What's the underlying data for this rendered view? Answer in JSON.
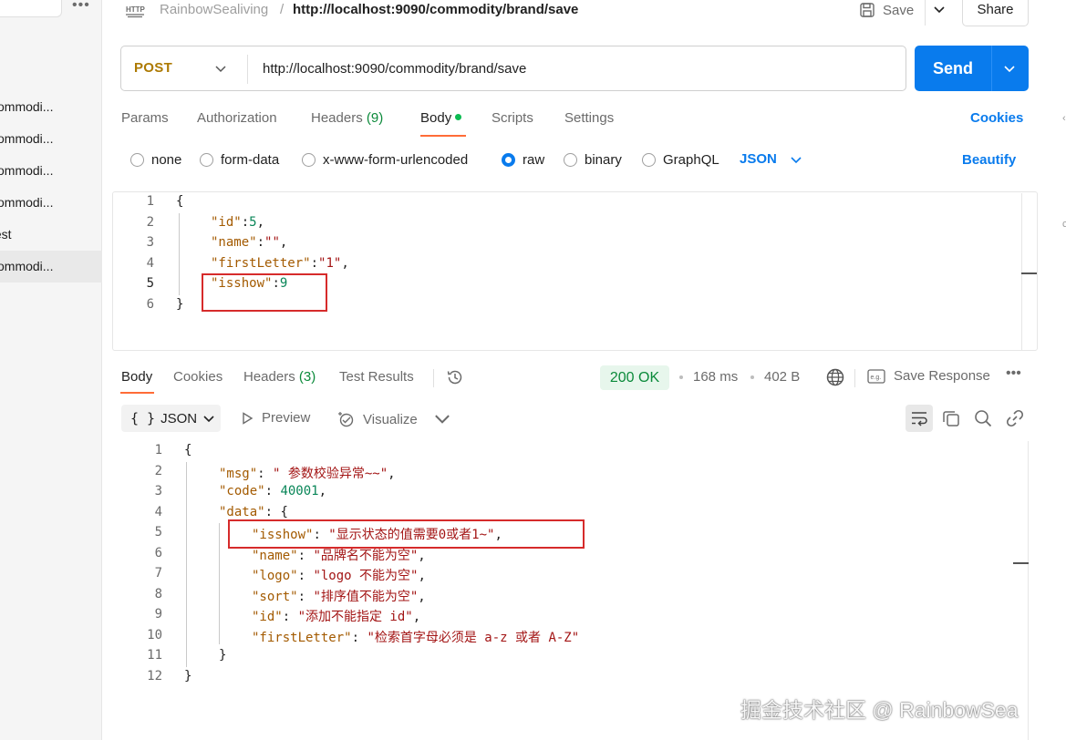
{
  "sidebar": {
    "more_glyph": "•••",
    "items": [
      {
        "label": "commodi..."
      },
      {
        "label": "commodi..."
      },
      {
        "label": "commodi..."
      },
      {
        "label": "commodi..."
      },
      {
        "label": "test"
      },
      {
        "label": "commodi..."
      }
    ]
  },
  "header": {
    "protocol_badge": "HTTP",
    "collection": "RainbowSealiving",
    "separator": "/",
    "title": "http://localhost:9090/commodity/brand/save",
    "save_label": "Save",
    "share_label": "Share"
  },
  "request": {
    "method": "POST",
    "url": "http://localhost:9090/commodity/brand/save",
    "send_label": "Send",
    "tabs": {
      "params": "Params",
      "authorization": "Authorization",
      "headers": "Headers",
      "headers_count": "(9)",
      "body": "Body",
      "scripts": "Scripts",
      "settings": "Settings"
    },
    "cookies_label": "Cookies",
    "body_types": {
      "none": "none",
      "form_data": "form-data",
      "urlencoded": "x-www-form-urlencoded",
      "raw": "raw",
      "binary": "binary",
      "graphql": "GraphQL"
    },
    "selected_body_type": "raw",
    "language": "JSON",
    "beautify_label": "Beautify",
    "code": {
      "line_numbers": [
        "1",
        "2",
        "3",
        "4",
        "5",
        "6"
      ],
      "l1": "{",
      "l2_key": "\"id\"",
      "l2_val": "5",
      "l3_key": "\"name\"",
      "l3_val": "\"\"",
      "l4_key": "\"firstLetter\"",
      "l4_val": "\"1\"",
      "l5_key": "\"isshow\"",
      "l5_val": "9",
      "l6": "}"
    }
  },
  "response": {
    "tabs": {
      "body": "Body",
      "cookies": "Cookies",
      "headers": "Headers",
      "headers_count": "(3)",
      "test_results": "Test Results"
    },
    "status": "200 OK",
    "time": "168 ms",
    "size": "402 B",
    "save_response_label": "Save Response",
    "format": "JSON",
    "format_glyph": "{ }",
    "preview_label": "Preview",
    "visualize_label": "Visualize",
    "code": {
      "line_numbers": [
        "1",
        "2",
        "3",
        "4",
        "5",
        "6",
        "7",
        "8",
        "9",
        "10",
        "11",
        "12"
      ],
      "l1": "{",
      "msg_key": "\"msg\"",
      "msg_val": "\" 参数校验异常~~\"",
      "code_key": "\"code\"",
      "code_val": "40001",
      "data_key": "\"data\"",
      "data_open": "{",
      "isshow_key": "\"isshow\"",
      "isshow_val": "\"显示状态的值需要0或者1~\"",
      "name_key": "\"name\"",
      "name_val": "\"品牌名不能为空\"",
      "logo_key": "\"logo\"",
      "logo_val": "\"logo 不能为空\"",
      "sort_key": "\"sort\"",
      "sort_val": "\"排序值不能为空\"",
      "id_key": "\"id\"",
      "id_val": "\"添加不能指定 id\"",
      "fl_key": "\"firstLetter\"",
      "fl_val": "\"检索首字母必须是 a-z 或者 A-Z\"",
      "data_close": "}",
      "l12": "}"
    }
  },
  "watermark": "掘金技术社区 @ RainbowSea",
  "colors": {
    "accent": "#097bed",
    "tab_underline": "#ff6c37",
    "method": "#ad7a03",
    "status_ok": "#0b8a3a",
    "highlight_box": "#d62b2b"
  }
}
